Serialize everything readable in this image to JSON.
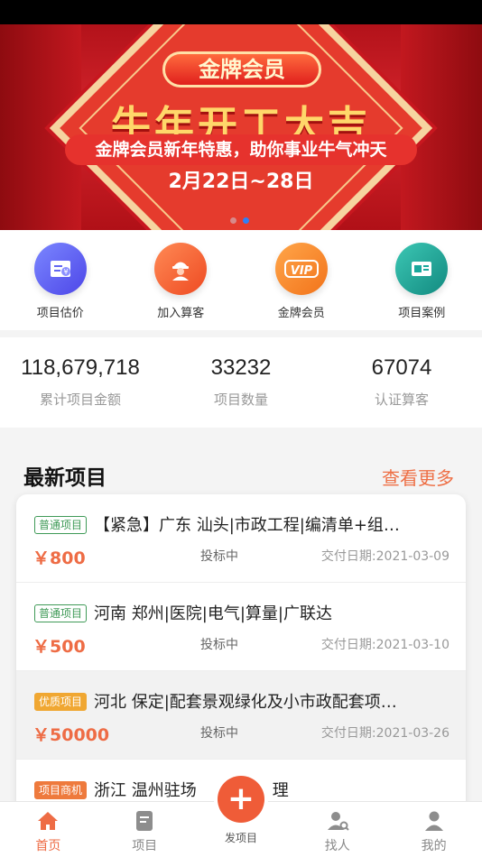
{
  "banner": {
    "tag": "金牌会员",
    "headline": "牛年开工大吉",
    "subline": "金牌会员新年特惠，助你事业牛气冲天",
    "date": "2月22日~28日"
  },
  "quick_menu": [
    {
      "label": "项目估价",
      "icon": "invoice-icon",
      "color": "#5b5ff0"
    },
    {
      "label": "加入算客",
      "icon": "worker-icon",
      "color": "#f25c2d"
    },
    {
      "label": "金牌会员",
      "icon": "vip-icon",
      "color": "#f6861f"
    },
    {
      "label": "项目案例",
      "icon": "id-card-icon",
      "color": "#1aa89c"
    }
  ],
  "stats": [
    {
      "value": "118,679,718",
      "label": "累计项目金额"
    },
    {
      "value": "33232",
      "label": "项目数量"
    },
    {
      "value": "67074",
      "label": "认证算客"
    }
  ],
  "section": {
    "title": "最新项目",
    "more": "查看更多"
  },
  "projects": [
    {
      "badge": "普通项目",
      "title": "【紧急】广东 汕头|市政工程|编清单+组…",
      "price": "￥800",
      "status": "投标中",
      "date": "交付日期:2021-03-09"
    },
    {
      "badge": "普通项目",
      "title": "河南 郑州|医院|电气|算量|广联达",
      "price": "￥500",
      "status": "投标中",
      "date": "交付日期:2021-03-10"
    },
    {
      "badge": "优质项目",
      "title": "河北 保定|配套景观绿化及小市政配套项…",
      "price": "￥50000",
      "status": "投标中",
      "date": "交付日期:2021-03-26"
    },
    {
      "badge": "项目商机",
      "title": "浙江 温州驻场",
      "title_tail": "理"
    }
  ],
  "tabbar": {
    "home": "首页",
    "projects": "项目",
    "publish": "发项目",
    "find": "找人",
    "mine": "我的"
  },
  "colors": {
    "accent": "#ee6c45",
    "green_badge": "#3f9a57",
    "gold_badge": "#f0a732"
  }
}
